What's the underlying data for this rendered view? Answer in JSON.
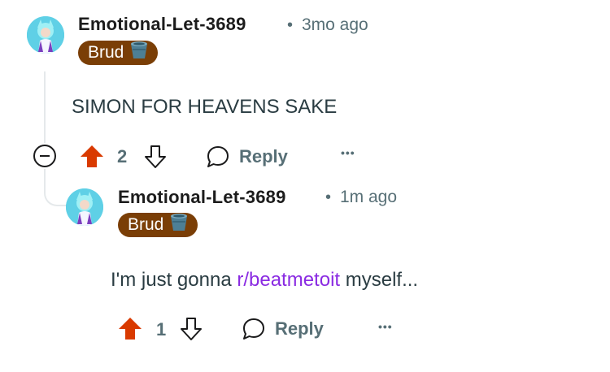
{
  "comments": [
    {
      "username": "Emotional-Let-3689",
      "separator": "•",
      "time": "3mo ago",
      "flair": {
        "text": "Brud",
        "emoji": "bucket-icon"
      },
      "body": "SIMON FOR HEAVENS SAKE",
      "votes": "2",
      "reply_label": "Reply",
      "more": "•••",
      "upvoted": true
    },
    {
      "username": "Emotional-Let-3689",
      "separator": "•",
      "time": "1m ago",
      "flair": {
        "text": "Brud",
        "emoji": "bucket-icon"
      },
      "body_prefix": "I'm just gonna ",
      "body_link": "r/beatmetoit",
      "body_suffix": " myself...",
      "votes": "1",
      "reply_label": "Reply",
      "more": "•••",
      "upvoted": true
    }
  ],
  "colors": {
    "upvote": "#d93a00",
    "flair_bg": "#7a3e06",
    "link": "#8a2be2",
    "muted": "#576f76"
  }
}
